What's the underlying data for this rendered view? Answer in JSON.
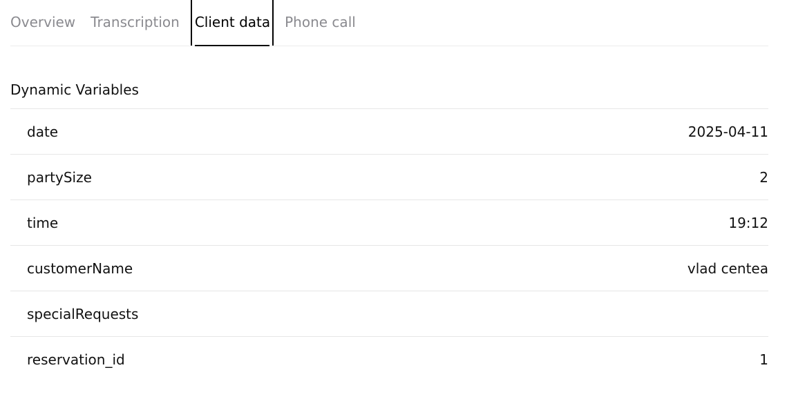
{
  "tabs": [
    {
      "label": "Overview"
    },
    {
      "label": "Transcription"
    },
    {
      "label": "Client data",
      "active": true
    },
    {
      "label": "Phone call"
    }
  ],
  "section": {
    "title": "Dynamic Variables"
  },
  "variables": [
    {
      "key": "date",
      "value": "2025-04-11"
    },
    {
      "key": "partySize",
      "value": "2"
    },
    {
      "key": "time",
      "value": "19:12"
    },
    {
      "key": "customerName",
      "value": "vlad centea"
    },
    {
      "key": "specialRequests",
      "value": ""
    },
    {
      "key": "reservation_id",
      "value": "1"
    }
  ]
}
